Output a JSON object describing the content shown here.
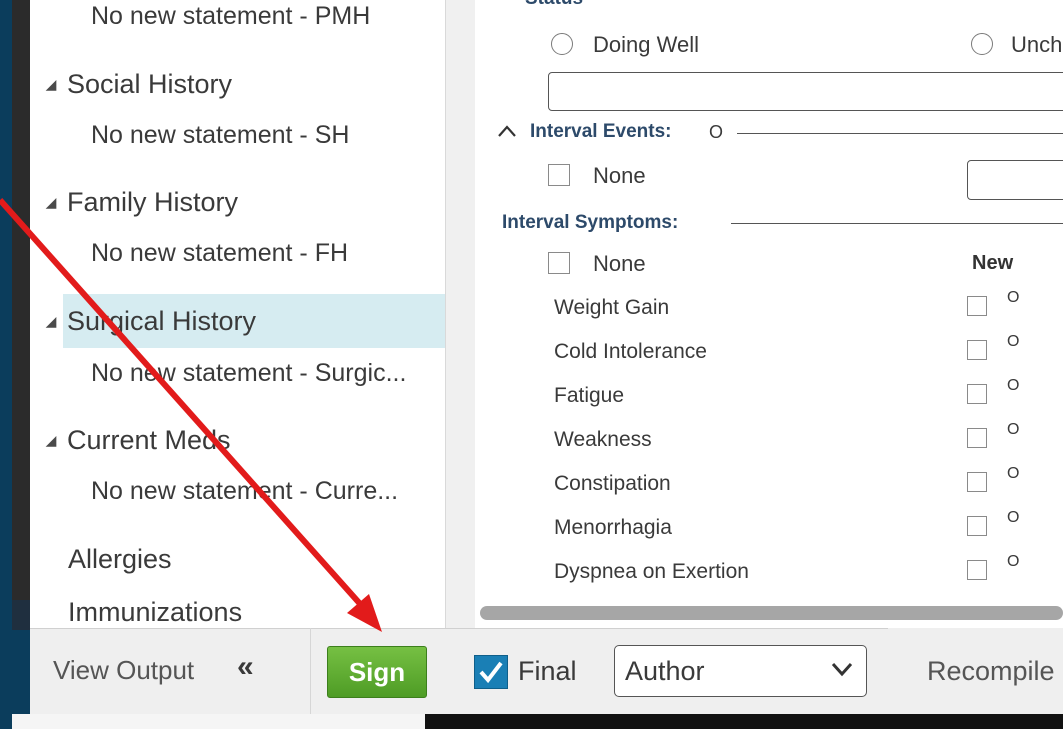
{
  "left_nav": {
    "items": [
      {
        "type": "sub",
        "text": "No new statement - PMH"
      },
      {
        "type": "head",
        "text": "Social History"
      },
      {
        "type": "sub",
        "text": "No new statement - SH"
      },
      {
        "type": "head",
        "text": "Family History"
      },
      {
        "type": "sub",
        "text": "No new statement - FH"
      },
      {
        "type": "head",
        "text": "Surgical History",
        "selected": true
      },
      {
        "type": "sub",
        "text": "No new statement - Surgic..."
      },
      {
        "type": "head",
        "text": "Current Meds"
      },
      {
        "type": "sub",
        "text": "No new statement - Curre..."
      },
      {
        "type": "plain",
        "text": "Allergies"
      },
      {
        "type": "plain",
        "text": "Immunizations"
      }
    ]
  },
  "form": {
    "status_partial": "Status",
    "status_options": [
      "Doing Well",
      "Unch"
    ],
    "interval_events": {
      "label": "Interval Events:",
      "marker": "O",
      "none_label": "None"
    },
    "interval_symptoms": {
      "label": "Interval Symptoms:",
      "none_label": "None",
      "column_new": "New",
      "marker": "O",
      "rows": [
        "Weight Gain",
        "Cold Intolerance",
        "Fatigue",
        "Weakness",
        "Constipation",
        "Menorrhagia",
        "Dyspnea on Exertion"
      ]
    }
  },
  "toolbar": {
    "view_output": "View Output",
    "collapse_glyph": "«",
    "sign_label": "Sign",
    "final_label": "Final",
    "final_checked": true,
    "author_selected": "Author",
    "recompile": "Recompile"
  },
  "colors": {
    "selected_row": "#d6ecf1",
    "sign_green": "#5aa92f",
    "final_check_blue": "#1a7fb5",
    "annotation_arrow": "#e21b1b"
  }
}
